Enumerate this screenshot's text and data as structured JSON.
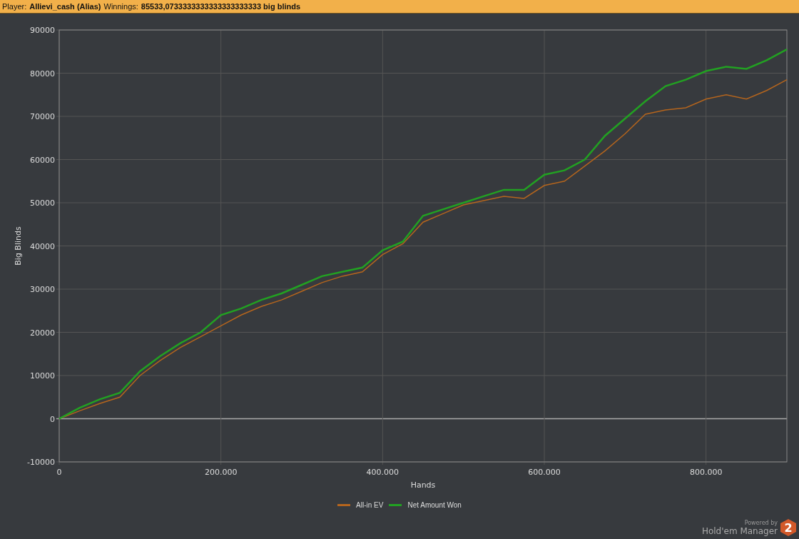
{
  "header": {
    "player_label": "Player:",
    "player": "Allievi_cash (Alias)",
    "winnings_label": "Winnings:",
    "winnings": "85533,0733333333333333333333 big blinds"
  },
  "chart": {
    "chart_data": {
      "type": "line",
      "xlabel": "Hands",
      "ylabel": "Big Blinds",
      "x": [
        0,
        25000,
        50000,
        75000,
        100000,
        125000,
        150000,
        175000,
        200000,
        225000,
        250000,
        275000,
        300000,
        325000,
        350000,
        375000,
        400000,
        425000,
        450000,
        475000,
        500000,
        525000,
        550000,
        575000,
        600000,
        625000,
        650000,
        675000,
        700000,
        725000,
        750000,
        775000,
        800000,
        825000,
        850000,
        875000,
        900000
      ],
      "series": [
        {
          "name": "All-in EV",
          "color": "#b5651d",
          "values": [
            0,
            1800,
            3500,
            5000,
            10000,
            13500,
            16500,
            19000,
            21500,
            24000,
            26000,
            27500,
            29500,
            31500,
            33000,
            34000,
            38000,
            40500,
            45500,
            47500,
            49500,
            50500,
            51500,
            51000,
            54000,
            55000,
            58500,
            62000,
            66000,
            70500,
            71500,
            72000,
            74000,
            75000,
            74000,
            76000,
            78500
          ]
        },
        {
          "name": "Net Amount Won",
          "color": "#22a122",
          "values": [
            0,
            2500,
            4500,
            6000,
            11000,
            14500,
            17500,
            20000,
            24000,
            25500,
            27500,
            29000,
            31000,
            33000,
            34000,
            35000,
            39000,
            41000,
            47000,
            48500,
            50000,
            51500,
            53000,
            53000,
            56500,
            57500,
            60000,
            65500,
            69500,
            73500,
            77000,
            78500,
            80500,
            81500,
            81000,
            83000,
            85500
          ]
        }
      ],
      "grid": true,
      "xlim": [
        0,
        900000
      ],
      "ylim": [
        -10000,
        90000
      ],
      "xticks": [
        {
          "value": 0,
          "label": "0"
        },
        {
          "value": 200000,
          "label": "200.000"
        },
        {
          "value": 400000,
          "label": "400.000"
        },
        {
          "value": 600000,
          "label": "600.000"
        },
        {
          "value": 800000,
          "label": "800.000"
        }
      ],
      "yticks": [
        -10000,
        0,
        10000,
        20000,
        30000,
        40000,
        50000,
        60000,
        70000,
        80000,
        90000
      ]
    }
  },
  "footer": {
    "powered_by": "Powered by",
    "product": "Hold'em Manager",
    "badge": "2"
  }
}
